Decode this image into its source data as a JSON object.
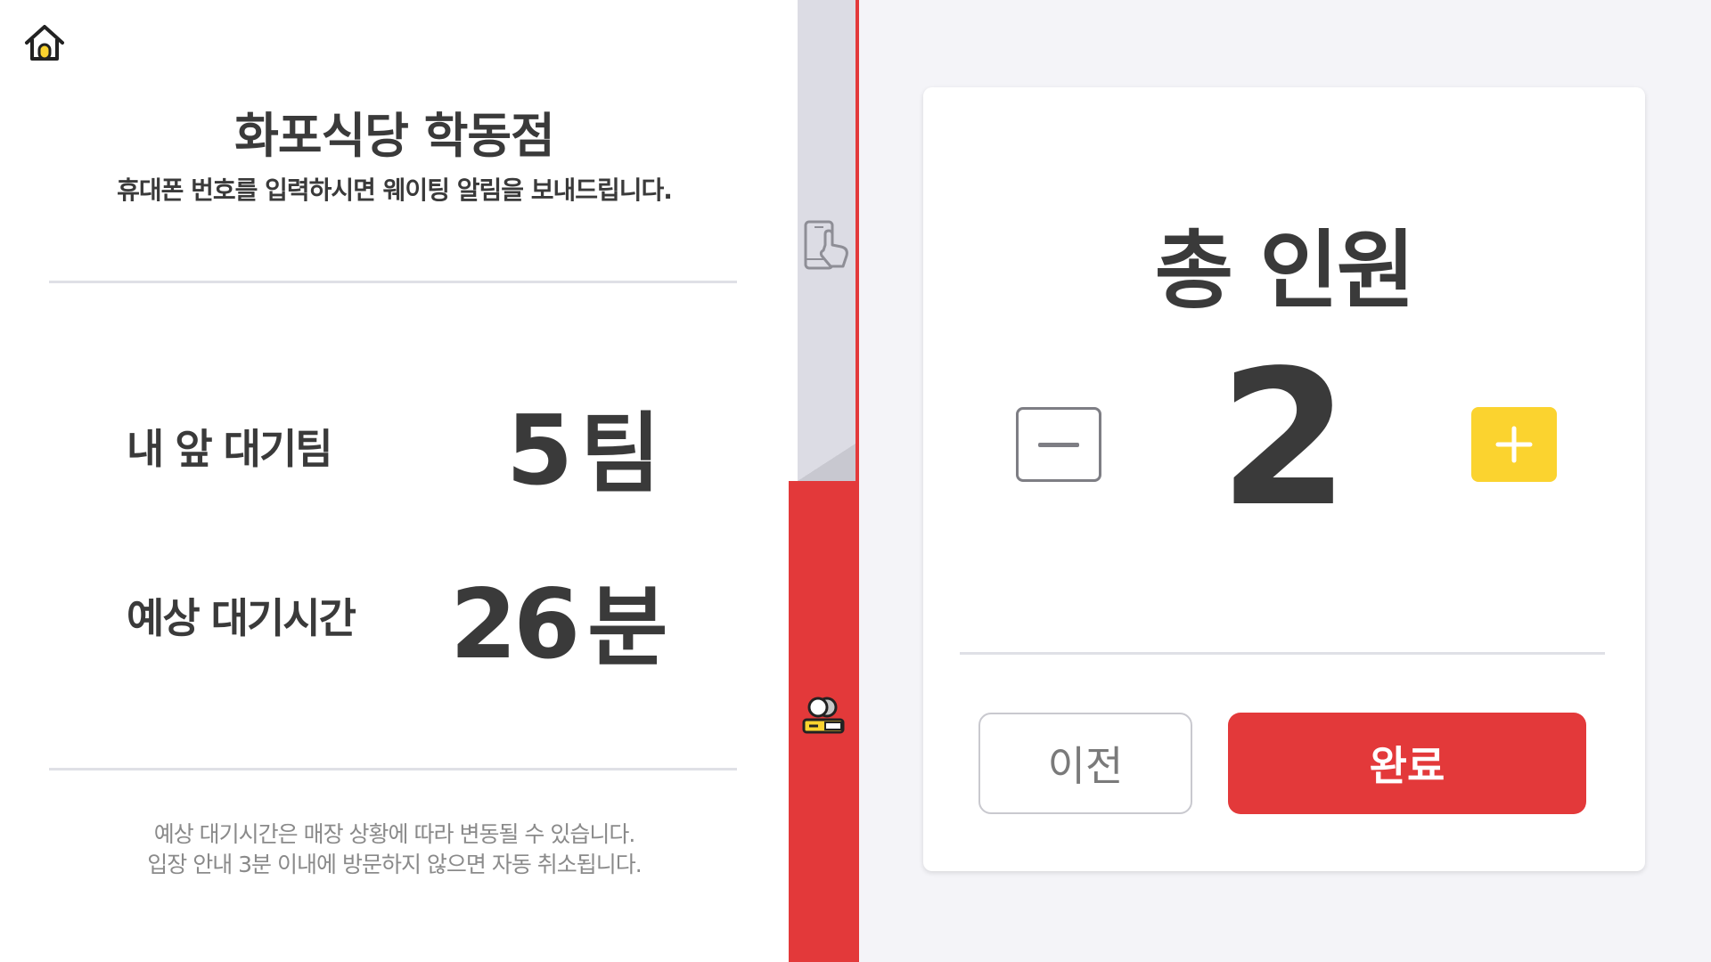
{
  "header": {
    "home_icon": "home-icon"
  },
  "store": {
    "name": "화포식당 학동점",
    "subtitle": "휴대폰 번호를 입력하시면 웨이팅 알림을 보내드립니다."
  },
  "stats": {
    "teams_label": "내 앞 대기팀",
    "teams_value": "5",
    "teams_unit": "팀",
    "time_label": "예상 대기시간",
    "time_value": "26",
    "time_unit": "분"
  },
  "notice": {
    "line1": "예상 대기시간은 매장 상황에 따라 변동될 수 있습니다.",
    "line2": "입장 안내 3분 이내에 방문하지 않으면 자동 취소됩니다."
  },
  "steps": {
    "phone_icon": "phone-touch-icon",
    "users_icon": "users-icon"
  },
  "party": {
    "title": "총 인원",
    "count": "2",
    "minus_icon": "minus-icon",
    "plus_icon": "plus-icon"
  },
  "actions": {
    "prev_label": "이전",
    "done_label": "완료"
  },
  "colors": {
    "accent_red": "#e3393a",
    "accent_yellow": "#fbd32f",
    "text_dark": "#3a3a3a",
    "text_muted": "#8a8a8a",
    "panel_bg": "#f4f4f8"
  }
}
